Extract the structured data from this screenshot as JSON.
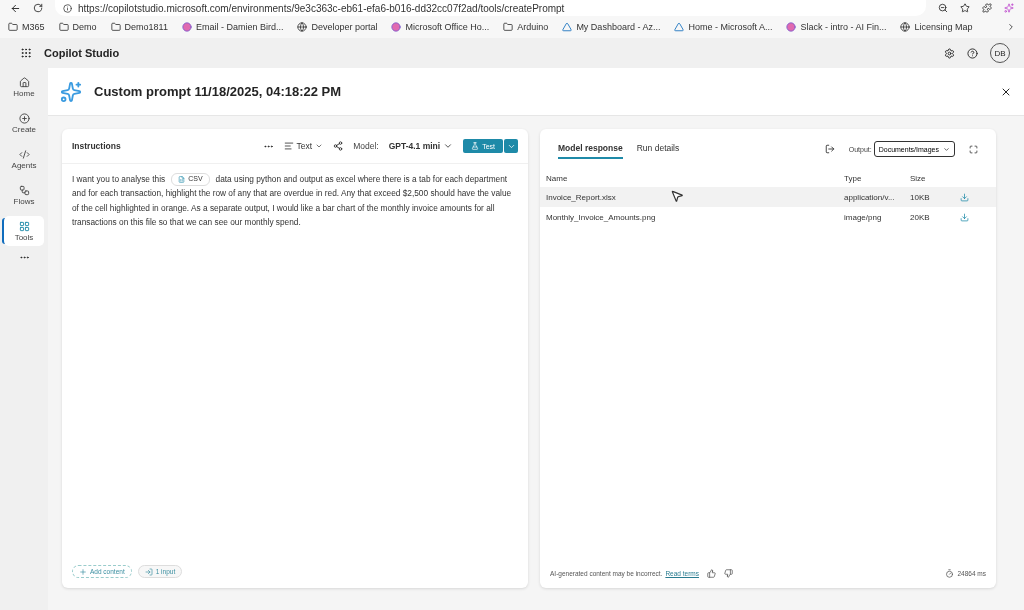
{
  "browser": {
    "url": "https://copilotstudio.microsoft.com/environments/9e3c363c-eb61-efa6-b016-dd32cc07f2ad/tools/createPrompt",
    "bookmarks": [
      {
        "label": "M365",
        "kind": "folder"
      },
      {
        "label": "Demo",
        "kind": "folder"
      },
      {
        "label": "Demo1811",
        "kind": "folder"
      },
      {
        "label": "Email - Damien Bird...",
        "kind": "site"
      },
      {
        "label": "Developer portal",
        "kind": "globe"
      },
      {
        "label": "Microsoft Office Ho...",
        "kind": "site"
      },
      {
        "label": "Arduino",
        "kind": "folder"
      },
      {
        "label": "My Dashboard - Az...",
        "kind": "azure"
      },
      {
        "label": "Home - Microsoft A...",
        "kind": "azure"
      },
      {
        "label": "Slack - intro - AI Fin...",
        "kind": "site"
      },
      {
        "label": "Licensing Map",
        "kind": "globe"
      }
    ]
  },
  "app": {
    "name": "Copilot Studio",
    "avatar": "DB"
  },
  "nav": [
    {
      "label": "Home",
      "kind": "home",
      "selected": false
    },
    {
      "label": "Create",
      "kind": "create",
      "selected": false
    },
    {
      "label": "Agents",
      "kind": "agents",
      "selected": false
    },
    {
      "label": "Flows",
      "kind": "flows",
      "selected": false
    },
    {
      "label": "Tools",
      "kind": "tools",
      "selected": true
    }
  ],
  "page": {
    "title": "Custom prompt 11/18/2025, 04:18:22 PM"
  },
  "instructions": {
    "title": "Instructions",
    "format": "Text",
    "model_label": "Model:",
    "model": "GPT-4.1 mini",
    "test": "Test",
    "prompt_before": "I want you to analyse this",
    "chip": "CSV",
    "prompt_after": "data using python and output as excel where there is a tab for each department",
    "prompt_rest": "and for each transaction, highlight the row of any that are overdue in red.  Any that exceed $2,500 should have the value of the cell highlighted in orange.  As a separate output, I would like a bar chart of the monthly invoice amounts for all transactions on this file so that we can see our monthly spend.",
    "add_content": "Add content",
    "inputs": "1 input"
  },
  "response": {
    "tabs": [
      {
        "label": "Model response",
        "selected": true
      },
      {
        "label": "Run details",
        "selected": false
      }
    ],
    "output_label": "Output:",
    "output": "Documents/Images",
    "columns": [
      "Name",
      "Type",
      "Size"
    ],
    "rows": [
      {
        "name": "Invoice_Report.xlsx",
        "type": "application/v...",
        "size": "10KB",
        "highlighted": true
      },
      {
        "name": "Monthly_Invoice_Amounts.png",
        "type": "image/png",
        "size": "20KB",
        "highlighted": false
      }
    ],
    "disclaimer": "AI-generated content may be incorrect.",
    "terms": "Read terms",
    "duration": "24864 ms"
  }
}
